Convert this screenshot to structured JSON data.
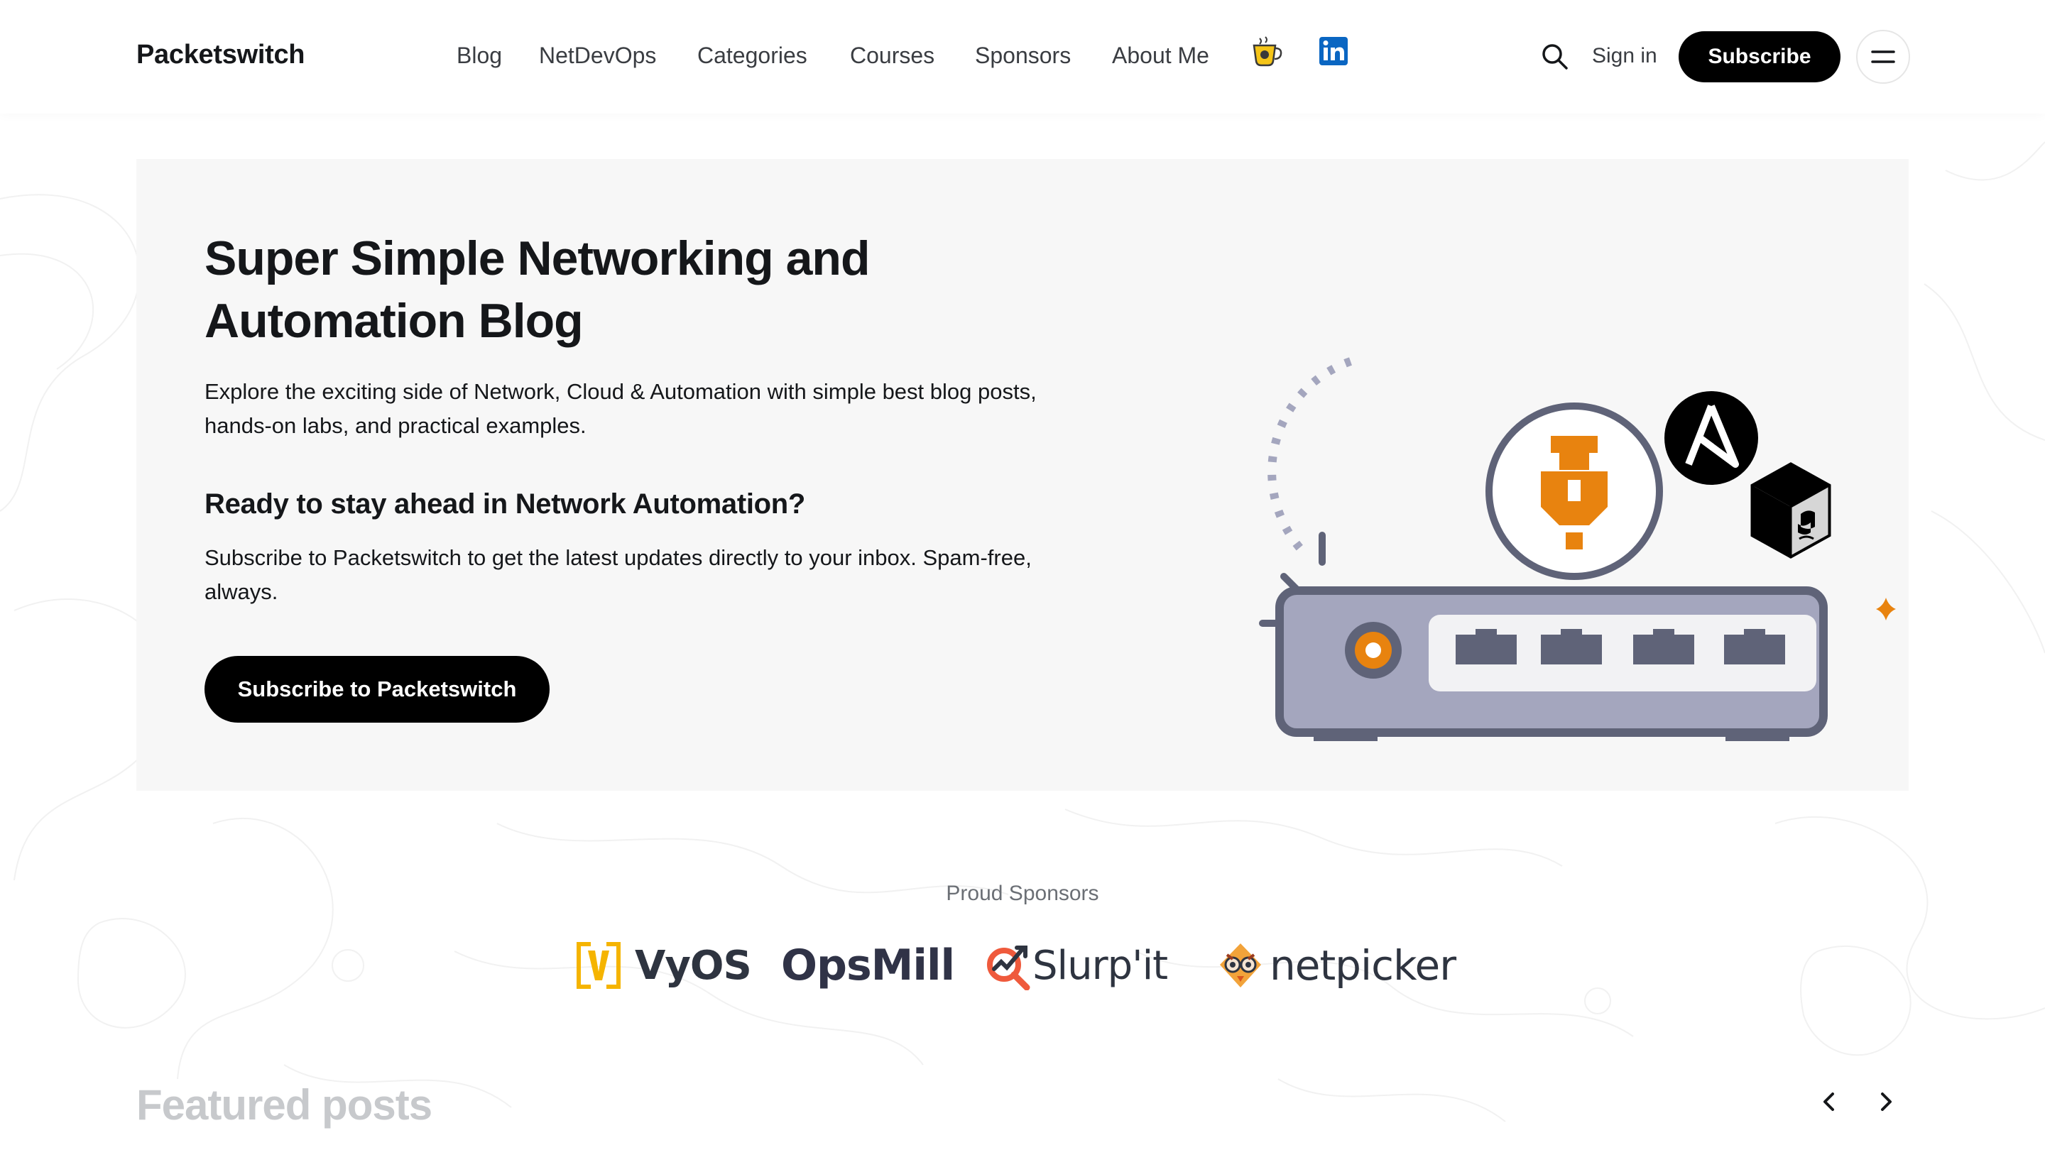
{
  "header": {
    "logo": "Packetswitch",
    "nav": [
      "Blog",
      "NetDevOps",
      "Categories",
      "Courses",
      "Sponsors",
      "About Me"
    ],
    "nav_icons": [
      "coffee-icon",
      "linkedin-icon"
    ],
    "signin_label": "Sign in",
    "subscribe_label": "Subscribe"
  },
  "hero": {
    "title": "Super Simple Networking and Automation Blog",
    "description": "Explore the exciting side of Network, Cloud & Automation with simple best blog posts, hands-on labs, and practical examples.",
    "subheading": "Ready to stay ahead in Network Automation?",
    "subheading_text": "Subscribe to Packetswitch to get the latest updates directly to your inbox. Spam-free, always.",
    "cta_label": "Subscribe to Packetswitch"
  },
  "sponsors": {
    "title": "Proud Sponsors",
    "items": [
      "VyOS",
      "OpsMill",
      "Slurp'it",
      "netpicker"
    ]
  },
  "featured": {
    "title": "Featured posts"
  },
  "colors": {
    "accent": "#000000",
    "illustration_orange": "#e8830f",
    "illustration_slate": "#5f6378",
    "illustration_lilac": "#a4a6be"
  }
}
